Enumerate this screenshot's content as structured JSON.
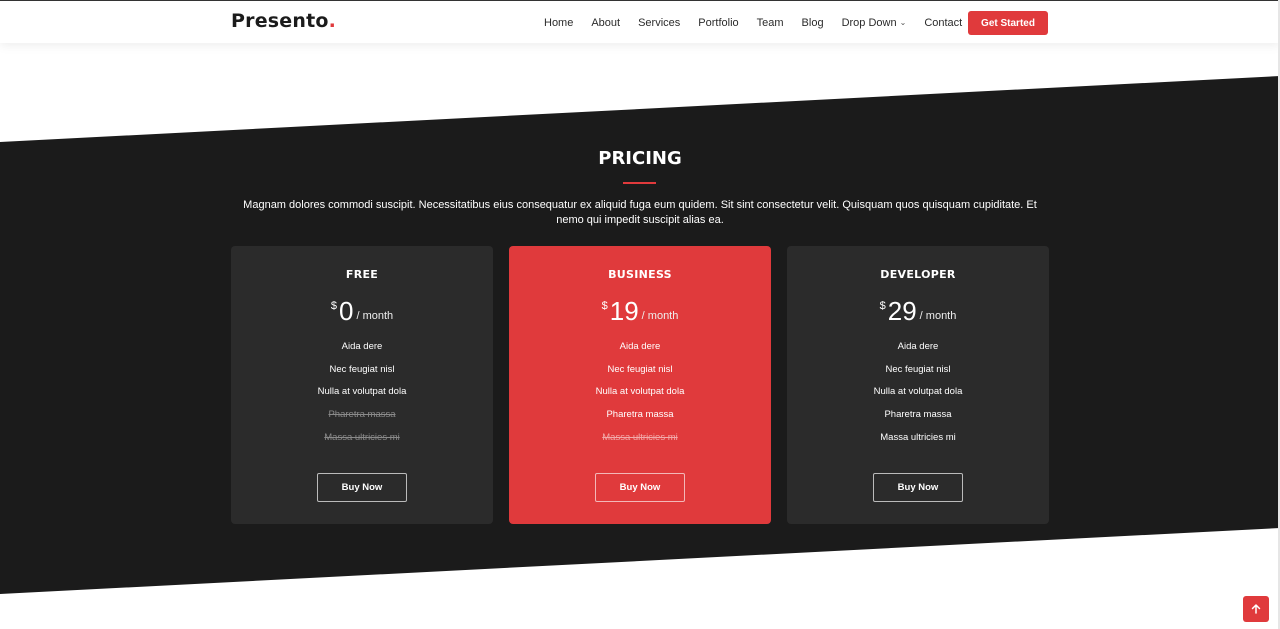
{
  "header": {
    "logo_text": "Presento",
    "logo_dot": ".",
    "nav": [
      {
        "label": "Home"
      },
      {
        "label": "About"
      },
      {
        "label": "Services"
      },
      {
        "label": "Portfolio"
      },
      {
        "label": "Team"
      },
      {
        "label": "Blog"
      },
      {
        "label": "Drop Down"
      },
      {
        "label": "Contact"
      }
    ],
    "cta_label": "Get Started"
  },
  "pricing": {
    "title": "PRICING",
    "description": "Magnam dolores commodi suscipit. Necessitatibus eius consequatur ex aliquid fuga eum quidem. Sit sint consectetur velit. Quisquam quos quisquam cupiditate. Et nemo qui impedit suscipit alias ea.",
    "plans": [
      {
        "name": "FREE",
        "currency": "$",
        "amount": "0",
        "period": "/ month",
        "features": [
          {
            "text": "Aida dere",
            "available": true
          },
          {
            "text": "Nec feugiat nisl",
            "available": true
          },
          {
            "text": "Nulla at volutpat dola",
            "available": true
          },
          {
            "text": "Pharetra massa",
            "available": false
          },
          {
            "text": "Massa ultricies mi",
            "available": false
          }
        ],
        "button_label": "Buy Now"
      },
      {
        "name": "BUSINESS",
        "currency": "$",
        "amount": "19",
        "period": "/ month",
        "features": [
          {
            "text": "Aida dere",
            "available": true
          },
          {
            "text": "Nec feugiat nisl",
            "available": true
          },
          {
            "text": "Nulla at volutpat dola",
            "available": true
          },
          {
            "text": "Pharetra massa",
            "available": true
          },
          {
            "text": "Massa ultricies mi",
            "available": false
          }
        ],
        "button_label": "Buy Now"
      },
      {
        "name": "DEVELOPER",
        "currency": "$",
        "amount": "29",
        "period": "/ month",
        "features": [
          {
            "text": "Aida dere",
            "available": true
          },
          {
            "text": "Nec feugiat nisl",
            "available": true
          },
          {
            "text": "Nulla at volutpat dola",
            "available": true
          },
          {
            "text": "Pharetra massa",
            "available": true
          },
          {
            "text": "Massa ultricies mi",
            "available": true
          }
        ],
        "button_label": "Buy Now"
      }
    ]
  },
  "back_to_top_icon": "arrow-up-icon",
  "colors": {
    "accent": "#e03a3c",
    "dark_section": "#1b1b1b",
    "card": "#2b2b2b"
  }
}
